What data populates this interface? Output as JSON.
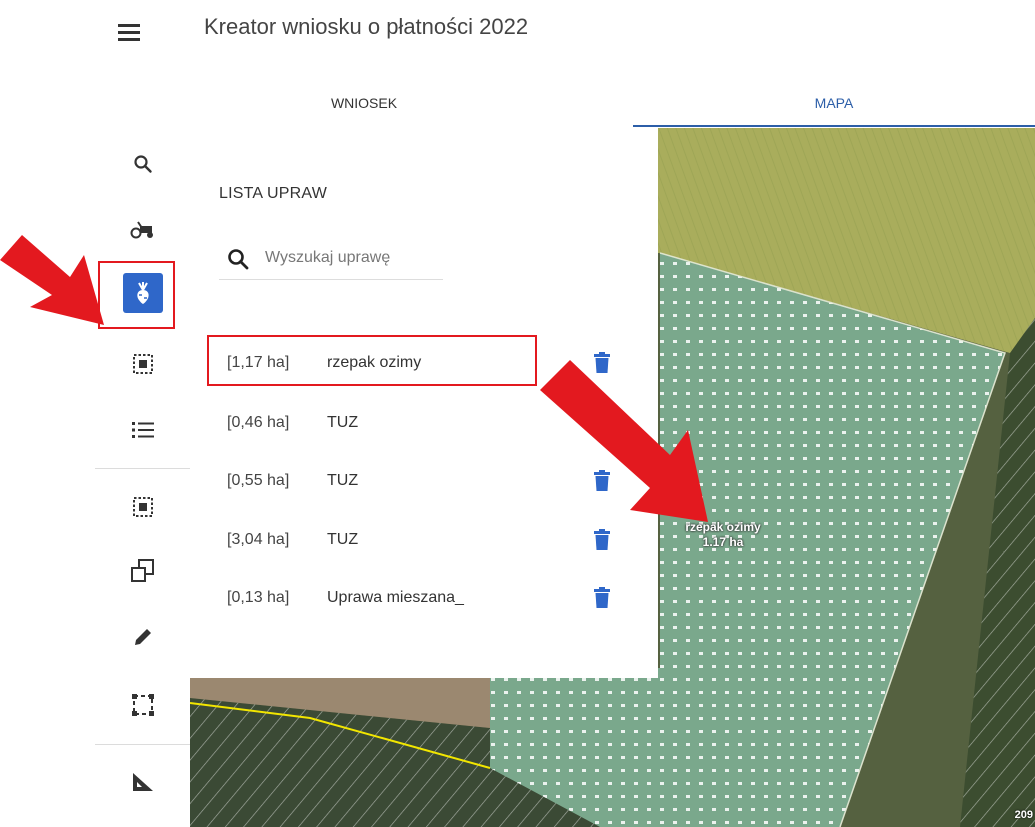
{
  "header": {
    "title": "Kreator wniosku o płatności 2022"
  },
  "tabs": [
    {
      "label": "WNIOSEK",
      "active": false
    },
    {
      "label": "MAPA",
      "active": true
    }
  ],
  "toolbar": {
    "tools": [
      {
        "icon": "search-icon"
      },
      {
        "icon": "tractor-icon"
      },
      {
        "icon": "crop-plant-icon",
        "active": true
      },
      {
        "icon": "select-parcel-icon"
      },
      {
        "icon": "list-icon"
      },
      {
        "icon": "select-area-icon"
      },
      {
        "icon": "copy-shape-icon"
      },
      {
        "icon": "pencil-icon"
      },
      {
        "icon": "draw-rectangle-icon"
      },
      {
        "icon": "measure-icon"
      }
    ],
    "active_color": "#2f67c9"
  },
  "panel": {
    "title": "LISTA UPRAW",
    "search_placeholder": "Wyszukaj uprawę",
    "crops": [
      {
        "area": "[1,17 ha]",
        "name": "rzepak ozimy",
        "has_delete": true,
        "highlighted": true
      },
      {
        "area": "[0,46 ha]",
        "name": "TUZ",
        "has_delete": false
      },
      {
        "area": "[0,55 ha]",
        "name": "TUZ",
        "has_delete": true
      },
      {
        "area": "[3,04 ha]",
        "name": "TUZ",
        "has_delete": true
      },
      {
        "area": "[0,13 ha]",
        "name": "Uprawa mieszana_",
        "has_delete": true
      }
    ]
  },
  "map": {
    "parcel_label_name": "rzepak ozimy",
    "parcel_label_area": "1.17 ha",
    "scale_text": "209",
    "accent_color": "#2c5ea8",
    "annotation_color": "#e3191f"
  }
}
